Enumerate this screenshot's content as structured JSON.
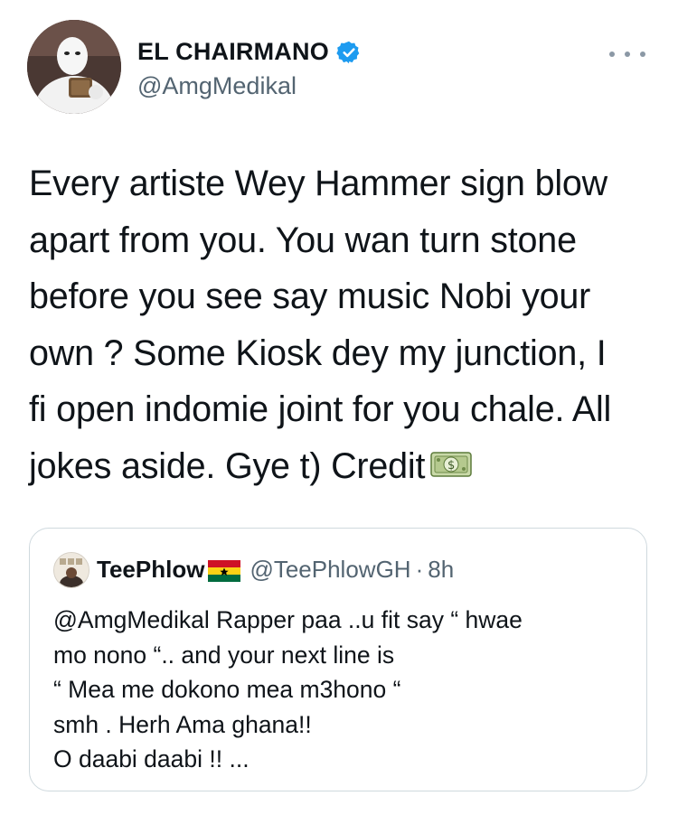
{
  "author": {
    "display_name": "EL CHAIRMANO",
    "handle": "@AmgMedikal",
    "verified": true
  },
  "more_icon": "more-horizontal-icon",
  "tweet": {
    "lines": [
      "Every artiste Wey Hammer sign blow",
      "apart from you. You wan turn stone",
      "before you see say music Nobi your",
      "own ? Some Kiosk dey my junction, I",
      "fi open indomie joint for you chale. All",
      "jokes aside. Gye t) Credit"
    ],
    "emoji": "money-bill-emoji"
  },
  "quoted_tweet": {
    "display_name": "TeePhlow",
    "flag": "ghana-flag-emoji",
    "handle": "@TeePhlowGH",
    "separator": "·",
    "time": "8h",
    "lines": [
      "@AmgMedikal Rapper paa ..u fit say “ hwae",
      "mo nono “.. and your next line is",
      "“ Mea me dokono mea m3hono “",
      "smh . Herh Ama ghana!!",
      "O daabi daabi !! ..."
    ]
  },
  "colors": {
    "text": "#0f1419",
    "secondary": "#536471",
    "verified_blue": "#1d9bf0",
    "border": "#cfd9de"
  }
}
